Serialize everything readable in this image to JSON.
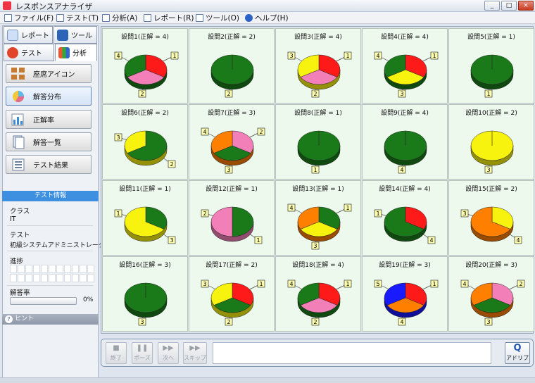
{
  "window": {
    "title": "レスポンスアナライザ"
  },
  "menu": [
    {
      "label": "ファイル(F)",
      "icon": "file-icon"
    },
    {
      "label": "テスト(T)",
      "icon": "test-icon"
    },
    {
      "label": "分析(A)",
      "icon": "analysis-icon"
    },
    {
      "label": "レポート(R)",
      "icon": "report-icon"
    },
    {
      "label": "ツール(O)",
      "icon": "tool-icon"
    },
    {
      "label": "ヘルプ(H)",
      "icon": "help-icon"
    }
  ],
  "side_tabs": [
    {
      "label": "レポート"
    },
    {
      "label": "ツール"
    },
    {
      "label": "テスト"
    },
    {
      "label": "分析"
    }
  ],
  "nav": [
    {
      "label": "座席アイコン"
    },
    {
      "label": "解答分布"
    },
    {
      "label": "正解率"
    },
    {
      "label": "解答一覧"
    },
    {
      "label": "テスト結果"
    }
  ],
  "info": {
    "header": "テスト情報",
    "class_label": "クラス",
    "class_value": "IT",
    "test_label": "テスト",
    "test_value": "初級システムアドミニストレータ",
    "progress_label": "進捗",
    "rate_label": "解答率",
    "rate_value": "0%",
    "rate_fraction": 0,
    "hint": "ヒント"
  },
  "colors": {
    "1": "#1a7a1a",
    "2": "#f27fb8",
    "3": "#f7f20e",
    "4": "#ff1a1a",
    "5": "#1a1aff",
    "orange": "#ff7f00"
  },
  "questions": [
    {
      "title": "設問1(正解 = 4)",
      "slices": [
        {
          "c": "4",
          "v": 1
        },
        {
          "c": "2",
          "v": 1
        },
        {
          "c": "1",
          "v": 1
        }
      ],
      "labels": [
        "4",
        "1",
        "2"
      ]
    },
    {
      "title": "設問2(正解 = 2)",
      "slices": [
        {
          "c": "1",
          "v": 1
        }
      ],
      "labels": [
        "2"
      ]
    },
    {
      "title": "設問3(正解 = 4)",
      "slices": [
        {
          "c": "4",
          "v": 1
        },
        {
          "c": "2",
          "v": 1
        },
        {
          "c": "3",
          "v": 1
        }
      ],
      "labels": [
        "3",
        "1",
        "2"
      ]
    },
    {
      "title": "設問4(正解 = 4)",
      "slices": [
        {
          "c": "4",
          "v": 1
        },
        {
          "c": "3",
          "v": 1
        },
        {
          "c": "1",
          "v": 1
        }
      ],
      "labels": [
        "4",
        "1",
        "3"
      ]
    },
    {
      "title": "設問5(正解 = 1)",
      "slices": [
        {
          "c": "1",
          "v": 1
        }
      ],
      "labels": [
        "1"
      ]
    },
    {
      "title": "設問6(正解 = 2)",
      "slices": [
        {
          "c": "1",
          "v": 2
        },
        {
          "c": "3",
          "v": 1
        }
      ],
      "labels": [
        "3",
        "2"
      ]
    },
    {
      "title": "設問7(正解 = 3)",
      "slices": [
        {
          "c": "2",
          "v": 1
        },
        {
          "c": "1",
          "v": 1
        },
        {
          "c": "orange",
          "v": 1
        }
      ],
      "labels": [
        "4",
        "2",
        "3"
      ]
    },
    {
      "title": "設問8(正解 = 1)",
      "slices": [
        {
          "c": "1",
          "v": 1
        }
      ],
      "labels": [
        "1"
      ]
    },
    {
      "title": "設問9(正解 = 4)",
      "slices": [
        {
          "c": "1",
          "v": 1
        }
      ],
      "labels": [
        "4"
      ]
    },
    {
      "title": "設問10(正解 = 2)",
      "slices": [
        {
          "c": "3",
          "v": 1
        }
      ],
      "labels": [
        "3"
      ]
    },
    {
      "title": "設問11(正解 = 1)",
      "slices": [
        {
          "c": "1",
          "v": 1
        },
        {
          "c": "3",
          "v": 2
        }
      ],
      "labels": [
        "1",
        "3"
      ]
    },
    {
      "title": "設問12(正解 = 1)",
      "slices": [
        {
          "c": "1",
          "v": 1
        },
        {
          "c": "2",
          "v": 1
        }
      ],
      "labels": [
        "2",
        "1"
      ]
    },
    {
      "title": "設問13(正解 = 1)",
      "slices": [
        {
          "c": "1",
          "v": 1
        },
        {
          "c": "3",
          "v": 1
        },
        {
          "c": "orange",
          "v": 1
        }
      ],
      "labels": [
        "4",
        "1",
        "3"
      ]
    },
    {
      "title": "設問14(正解 = 4)",
      "slices": [
        {
          "c": "4",
          "v": 1
        },
        {
          "c": "1",
          "v": 2
        }
      ],
      "labels": [
        "1",
        "4"
      ]
    },
    {
      "title": "設問15(正解 = 2)",
      "slices": [
        {
          "c": "3",
          "v": 1
        },
        {
          "c": "orange",
          "v": 2
        }
      ],
      "labels": [
        "3",
        "4"
      ]
    },
    {
      "title": "設問16(正解 = 3)",
      "slices": [
        {
          "c": "1",
          "v": 1
        }
      ],
      "labels": [
        "3"
      ]
    },
    {
      "title": "設問17(正解 = 2)",
      "slices": [
        {
          "c": "4",
          "v": 1
        },
        {
          "c": "1",
          "v": 1
        },
        {
          "c": "3",
          "v": 1
        }
      ],
      "labels": [
        "3",
        "1",
        "2"
      ]
    },
    {
      "title": "設問18(正解 = 4)",
      "slices": [
        {
          "c": "4",
          "v": 1
        },
        {
          "c": "2",
          "v": 1
        },
        {
          "c": "1",
          "v": 1
        }
      ],
      "labels": [
        "4",
        "1",
        "2"
      ]
    },
    {
      "title": "設問19(正解 = 3)",
      "slices": [
        {
          "c": "4",
          "v": 1
        },
        {
          "c": "orange",
          "v": 1
        },
        {
          "c": "5",
          "v": 1
        }
      ],
      "labels": [
        "5",
        "1",
        "4"
      ]
    },
    {
      "title": "設問20(正解 = 3)",
      "slices": [
        {
          "c": "2",
          "v": 1
        },
        {
          "c": "1",
          "v": 1
        },
        {
          "c": "orange",
          "v": 1
        }
      ],
      "labels": [
        "4",
        "2",
        "3"
      ]
    }
  ],
  "controls": [
    {
      "label": "終了",
      "glyph": "■"
    },
    {
      "label": "ポーズ",
      "glyph": "❚❚"
    },
    {
      "label": "次へ",
      "glyph": "▶▶"
    },
    {
      "label": "スキップ",
      "glyph": "▶▶"
    }
  ],
  "adrip": {
    "label": "アドリブ",
    "glyph": "Q"
  }
}
